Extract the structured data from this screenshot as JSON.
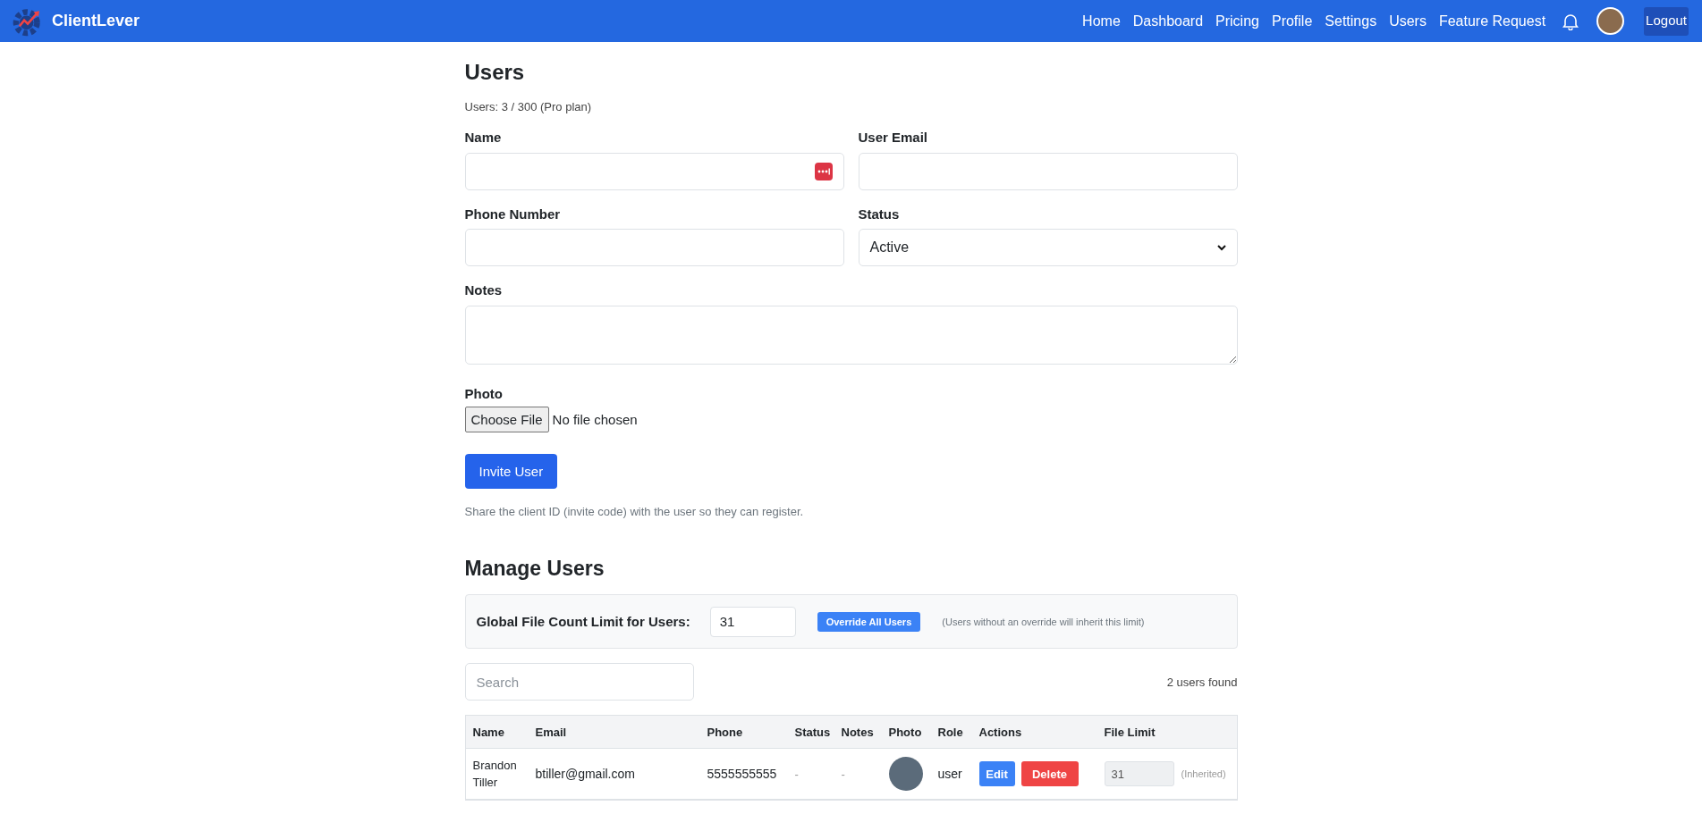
{
  "navbar": {
    "brand": "ClientLever",
    "links": [
      {
        "label": "Home"
      },
      {
        "label": "Dashboard"
      },
      {
        "label": "Pricing"
      },
      {
        "label": "Profile"
      },
      {
        "label": "Settings"
      },
      {
        "label": "Users"
      },
      {
        "label": "Feature Request"
      }
    ],
    "logout": "Logout"
  },
  "form": {
    "title": "Users",
    "usage": "Users: 3 / 300 (Pro plan)",
    "fields": [
      {
        "kind": "text",
        "label": "Name",
        "password_manager": true
      },
      {
        "kind": "text",
        "label": "User Email",
        "password_manager": false
      },
      {
        "kind": "text",
        "label": "Phone Number",
        "password_manager": false
      },
      {
        "kind": "select",
        "label": "Status",
        "value": "Active"
      },
      {
        "kind": "textarea",
        "label": "Notes"
      }
    ],
    "photo": {
      "label": "Photo",
      "button": "Choose File",
      "status": "No file chosen"
    },
    "submit": "Invite User",
    "hint": "Share the client ID (invite code) with the user so they can register."
  },
  "manage": {
    "title": "Manage Users",
    "limit_label": "Global File Count Limit for Users:",
    "limit_value": "31",
    "override_button": "Override All Users",
    "limit_note": "(Users without an override will inherit this limit)",
    "search": {
      "placeholder": "Search"
    },
    "count": "2 users found",
    "table": {
      "columns": [
        "Name",
        "Email",
        "Phone",
        "Status",
        "Notes",
        "Photo",
        "Role",
        "Actions",
        "File Limit"
      ],
      "rows": [
        {
          "name": "Brandon Tiller",
          "email": "btiller@gmail.com",
          "phone": "5555555555",
          "status": "-",
          "notes": "-",
          "role": "user",
          "edit": "Edit",
          "delete": "Delete",
          "file_limit": "31",
          "limit_note": "(Inherited)"
        }
      ]
    }
  }
}
